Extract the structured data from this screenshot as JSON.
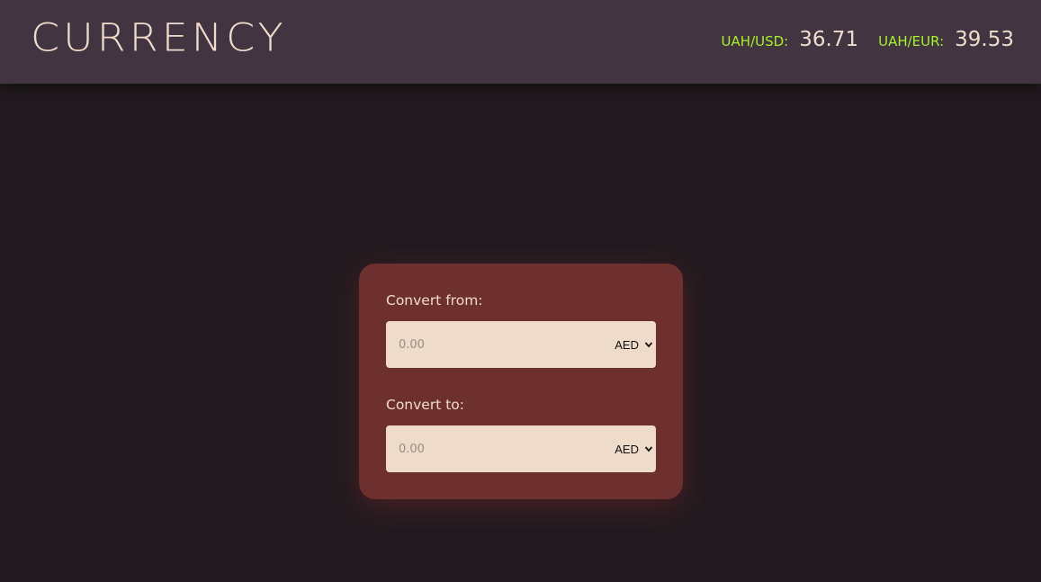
{
  "header": {
    "logo": "CURRENCY",
    "rates": [
      {
        "label": "UAH/USD:",
        "value": "36.71"
      },
      {
        "label": "UAH/EUR:",
        "value": "39.53"
      }
    ]
  },
  "converter": {
    "from": {
      "label": "Convert from:",
      "placeholder": "0.00",
      "currency": "AED"
    },
    "to": {
      "label": "Convert to:",
      "placeholder": "0.00",
      "currency": "AED"
    }
  },
  "colors": {
    "background": "#221a1f",
    "header": "#433441",
    "card": "#6e2f2f",
    "field": "#eedbc9",
    "rate_label": "#a6f12b",
    "text": "#f0dccb"
  }
}
